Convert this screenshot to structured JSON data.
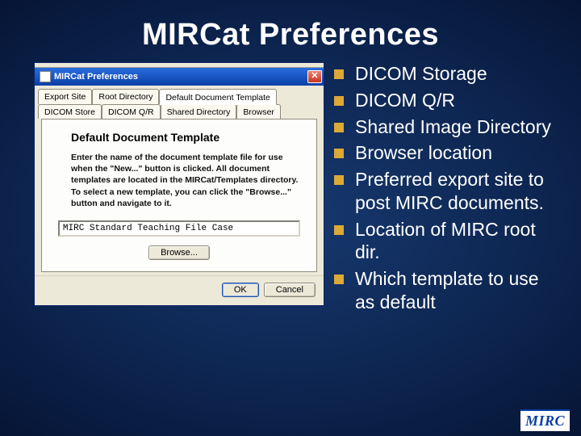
{
  "slide": {
    "title": "MIRCat Preferences"
  },
  "dialog": {
    "window_title": "MIRCat Preferences",
    "close_glyph": "✕",
    "tabs_row1": [
      {
        "label": "Export Site"
      },
      {
        "label": "Root Directory"
      },
      {
        "label": "Default Document Template",
        "active": true
      }
    ],
    "tabs_row2": [
      {
        "label": "DICOM Store"
      },
      {
        "label": "DICOM Q/R"
      },
      {
        "label": "Shared Directory"
      },
      {
        "label": "Browser"
      }
    ],
    "panel": {
      "heading": "Default Document Template",
      "body": "Enter the name of the document template file for use when the \"New...\" button is clicked. All document templates are located in the MIRCat/Templates directory.\nTo select a new template, you can click the \"Browse...\" button and navigate to it.",
      "input_value": "MIRC Standard Teaching File Case",
      "browse_label": "Browse..."
    },
    "buttons": {
      "ok": "OK",
      "cancel": "Cancel"
    }
  },
  "bullets": [
    "DICOM Storage",
    "DICOM Q/R",
    "Shared Image Directory",
    "Browser location",
    "Preferred export site to post MIRC documents.",
    "Location of MIRC root dir.",
    "Which template to use as default"
  ],
  "logo": {
    "text": "MIRC"
  }
}
